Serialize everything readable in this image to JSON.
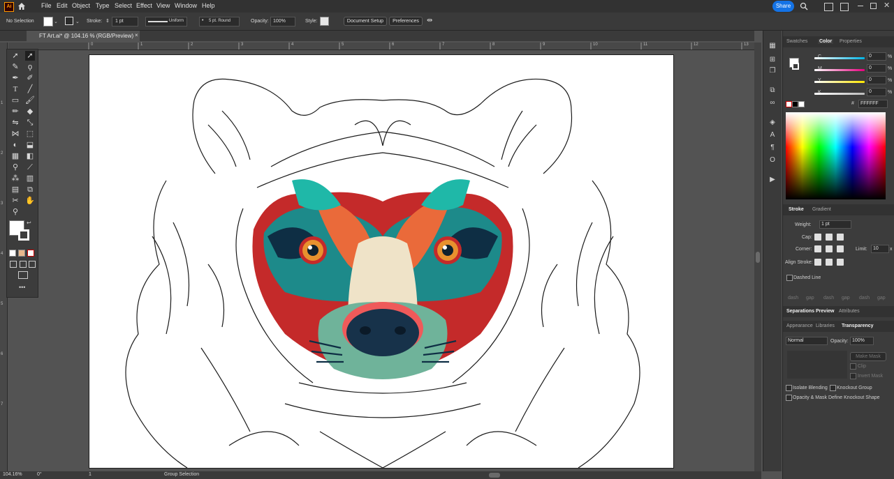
{
  "menubar": {
    "app_icon": "Ai",
    "home_icon": "home-icon",
    "items": [
      "File",
      "Edit",
      "Object",
      "Type",
      "Select",
      "Effect",
      "View",
      "Window",
      "Help"
    ],
    "share_label": "Share"
  },
  "control": {
    "selection": "No Selection",
    "stroke_label": "Stroke:",
    "stroke_value": "1 pt",
    "profile": "Uniform",
    "brush": "5 pt. Round",
    "opacity_label": "Opacity:",
    "opacity_value": "100%",
    "style_label": "Style:",
    "document_setup": "Document Setup",
    "preferences": "Preferences"
  },
  "document": {
    "tab_title": "FT Art.ai* @ 104.16 % (RGB/Preview)",
    "close": "×"
  },
  "status": {
    "zoom": "104.16%",
    "angle": "0°",
    "artboard": "1",
    "tool": "Group Selection"
  },
  "color_panel": {
    "tabs": [
      "Swatches",
      "Color",
      "Properties"
    ],
    "channels": [
      {
        "label": "C",
        "value": "0",
        "unit": "%",
        "color": "#00b4e6"
      },
      {
        "label": "M",
        "value": "0",
        "unit": "%",
        "color": "#e6007e"
      },
      {
        "label": "Y",
        "value": "0",
        "unit": "%",
        "color": "#ffe600"
      },
      {
        "label": "K",
        "value": "0",
        "unit": "%",
        "color": "#bcbcbc"
      }
    ],
    "hex_prefix": "#",
    "hex": "FFFFFF"
  },
  "stroke_panel": {
    "tabs": [
      "Stroke",
      "Gradient"
    ],
    "weight_label": "Weight:",
    "weight_value": "1 pt",
    "cap_label": "Cap:",
    "corner_label": "Corner:",
    "limit_label": "Limit:",
    "limit_value": "10",
    "limit_unit": "x",
    "align_label": "Align Stroke:",
    "dashed_label": "Dashed Line",
    "dash_labels": [
      "dash",
      "gap",
      "dash",
      "gap",
      "dash",
      "gap"
    ]
  },
  "separations": {
    "tabs": [
      "Separations Preview",
      "Attributes"
    ]
  },
  "transparency": {
    "tabs": [
      "Appearance",
      "Libraries",
      "Transparency"
    ],
    "blend": "Normal",
    "opacity_label": "Opacity:",
    "opacity_value": "100%",
    "make_mask": "Make Mask",
    "clip": "Clip",
    "invert_mask": "Invert Mask",
    "isolate": "Isolate Blending",
    "knockout": "Knockout Group",
    "opacity_mask": "Opacity & Mask Define Knockout Shape"
  },
  "ruler_marks": [
    "0",
    "1",
    "2",
    "3",
    "4",
    "5",
    "6",
    "7",
    "8",
    "9",
    "10",
    "11",
    "12",
    "13"
  ],
  "vruler_marks": [
    "1",
    "2",
    "3",
    "4",
    "5",
    "6",
    "7"
  ]
}
